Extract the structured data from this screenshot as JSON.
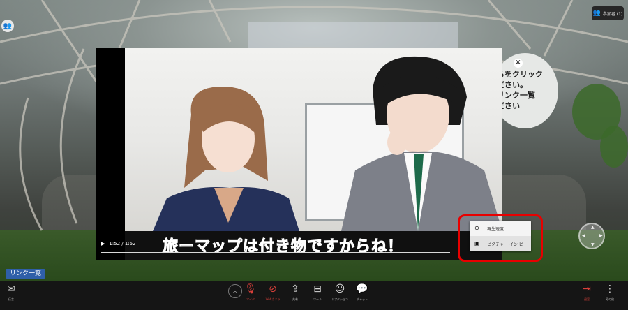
{
  "participants": {
    "label": "参加者 (1)",
    "icon": "people-icon"
  },
  "bubble": {
    "text": "らをクリック\nださい。\nリンク一覧\nださい"
  },
  "video": {
    "subtitle": "旅ーマップは付き物ですからね！",
    "time": "1:52 / 1:52",
    "progress": 1.0
  },
  "context_menu": {
    "items": [
      {
        "label": "再生速度",
        "icon": "playback-speed-icon"
      },
      {
        "label": "ピクチャー イン ピ",
        "icon": "picture-in-picture-icon"
      }
    ]
  },
  "link_list": {
    "label": "リンク一覧"
  },
  "toolbar": {
    "message": {
      "label": "伝言",
      "icon": "mail-icon"
    },
    "mic": {
      "label": "マイク",
      "icon": "mic-off-icon"
    },
    "webcam": {
      "label": "Webカメラ",
      "icon": "camera-off-icon"
    },
    "share": {
      "label": "共有",
      "icon": "share-screen-icon"
    },
    "tools": {
      "label": "ツール",
      "icon": "toolbox-icon"
    },
    "reaction": {
      "label": "リアクション",
      "icon": "smile-icon"
    },
    "chat": {
      "label": "チャット",
      "icon": "chat-icon"
    },
    "exit": {
      "label": "退室",
      "icon": "exit-icon"
    },
    "more": {
      "label": "その他",
      "icon": "more-icon"
    }
  },
  "colors": {
    "danger": "#d8403a",
    "highlight": "#e80000",
    "link_button": "#2f5fa8"
  }
}
